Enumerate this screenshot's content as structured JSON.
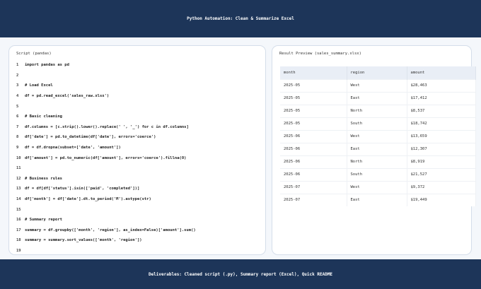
{
  "header": {
    "title": "Python Automation: Clean & Summarize Excel"
  },
  "script_panel": {
    "title": "Script (pandas)",
    "lines": [
      {
        "n": "1",
        "code": "import pandas as pd"
      },
      {
        "n": "2",
        "code": ""
      },
      {
        "n": "3",
        "code": "# Load Excel"
      },
      {
        "n": "4",
        "code": "df = pd.read_excel('sales_raw.xlsx')"
      },
      {
        "n": "5",
        "code": ""
      },
      {
        "n": "6",
        "code": "# Basic cleaning"
      },
      {
        "n": "7",
        "code": "df.columns = [c.strip().lower().replace(' ', '_') for c in df.columns]"
      },
      {
        "n": "8",
        "code": "df['date'] = pd.to_datetime(df['date'], errors='coerce')"
      },
      {
        "n": "9",
        "code": "df = df.dropna(subset=['date', 'amount'])"
      },
      {
        "n": "10",
        "code": "df['amount'] = pd.to_numeric(df['amount'], errors='coerce').fillna(0)"
      },
      {
        "n": "11",
        "code": ""
      },
      {
        "n": "12",
        "code": "# Business rules"
      },
      {
        "n": "13",
        "code": "df = df[df['status'].isin(['paid', 'completed'])]"
      },
      {
        "n": "14",
        "code": "df['month'] = df['date'].dt.to_period('M').astype(str)"
      },
      {
        "n": "15",
        "code": ""
      },
      {
        "n": "16",
        "code": "# Summary report"
      },
      {
        "n": "17",
        "code": "summary = df.groupby(['month', 'region'], as_index=False)['amount'].sum()"
      },
      {
        "n": "18",
        "code": "summary = summary.sort_values(['month', 'region'])"
      },
      {
        "n": "19",
        "code": ""
      }
    ]
  },
  "result_panel": {
    "title": "Result Preview (sales_summary.xlsx)",
    "columns": [
      "month",
      "region",
      "amount"
    ],
    "rows": [
      [
        "2025-05",
        "West",
        "$28,463"
      ],
      [
        "2025-05",
        "East",
        "$17,412"
      ],
      [
        "2025-05",
        "North",
        "$8,537"
      ],
      [
        "2025-05",
        "South",
        "$18,742"
      ],
      [
        "2025-06",
        "West",
        "$13,659"
      ],
      [
        "2025-06",
        "East",
        "$12,307"
      ],
      [
        "2025-06",
        "North",
        "$8,919"
      ],
      [
        "2025-06",
        "South",
        "$21,527"
      ],
      [
        "2025-07",
        "West",
        "$9,372"
      ],
      [
        "2025-07",
        "East",
        "$19,449"
      ]
    ]
  },
  "footer": {
    "text": "Deliverables: Cleaned script (.py), Summary report (Excel), Quick README"
  }
}
